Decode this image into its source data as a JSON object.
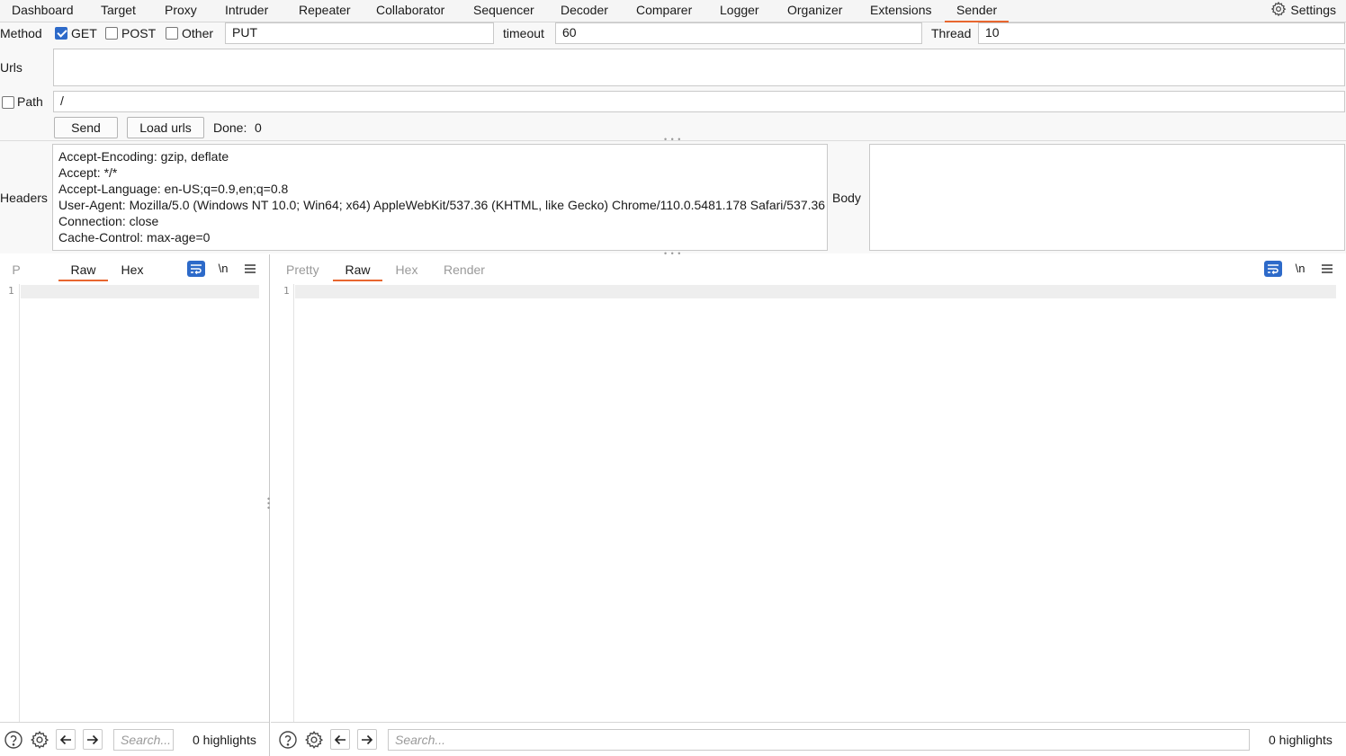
{
  "tabs": [
    "Dashboard",
    "Target",
    "Proxy",
    "Intruder",
    "Repeater",
    "Collaborator",
    "Sequencer",
    "Decoder",
    "Comparer",
    "Logger",
    "Organizer",
    "Extensions",
    "Sender"
  ],
  "settings_label": "Settings",
  "config": {
    "method_label": "Method",
    "get_label": "GET",
    "post_label": "POST",
    "other_label": "Other",
    "method_value": "PUT",
    "timeout_label": "timeout",
    "timeout_value": "60",
    "thread_label": "Thread",
    "thread_value": "10",
    "urls_label": "Urls",
    "path_label": "Path",
    "path_value": "/",
    "send_label": "Send",
    "load_urls_label": "Load urls",
    "done_label": "Done:",
    "done_value": "0"
  },
  "headers_label": "Headers",
  "body_label": "Body",
  "headers_lines": [
    "Accept-Encoding: gzip, deflate",
    "Accept: */*",
    "Accept-Language: en-US;q=0.9,en;q=0.8",
    "User-Agent: Mozilla/5.0 (Windows NT 10.0; Win64; x64) AppleWebKit/537.36 (KHTML, like Gecko) Chrome/110.0.5481.178 Safari/537.36",
    "Connection: close",
    "Cache-Control: max-age=0"
  ],
  "left_editor": {
    "tabs": [
      "P",
      "Raw",
      "Hex"
    ],
    "newline_label": "\\n",
    "line_number": "1",
    "search_placeholder": "Search...",
    "highlights": "0 highlights"
  },
  "right_editor": {
    "tabs": [
      "Pretty",
      "Raw",
      "Hex",
      "Render"
    ],
    "newline_label": "\\n",
    "line_number": "1",
    "search_placeholder": "Search...",
    "highlights": "0 highlights"
  },
  "colors": {
    "accent_orange": "#e8662f",
    "accent_blue": "#2d6ac9"
  }
}
